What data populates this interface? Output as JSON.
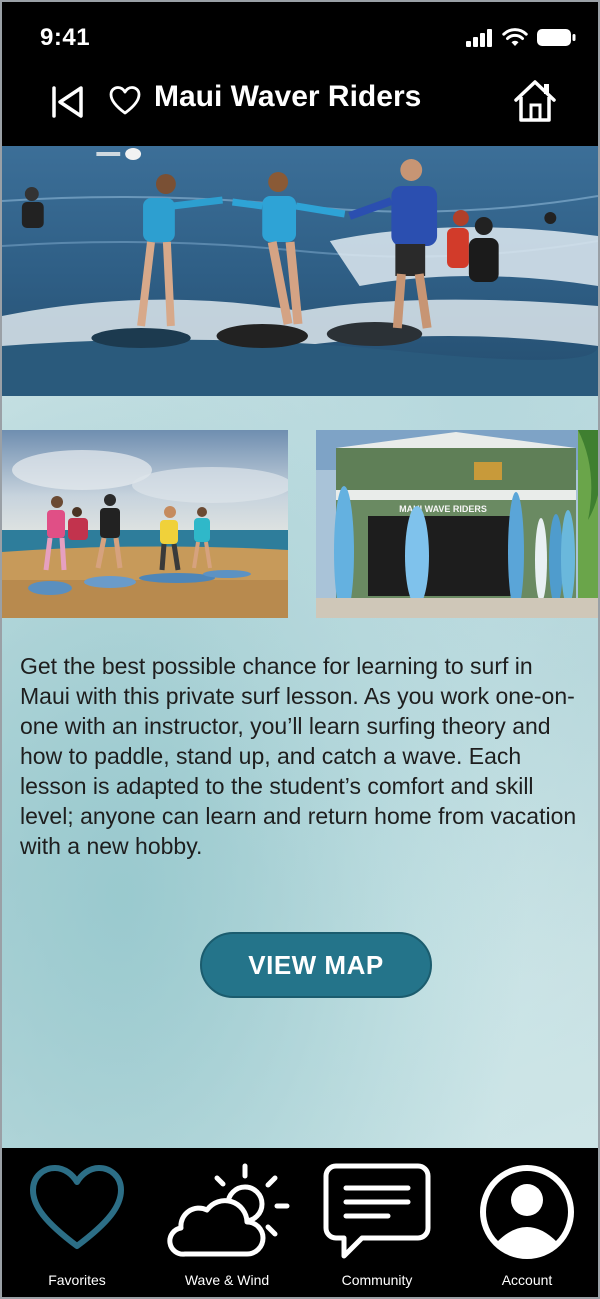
{
  "status_bar": {
    "time": "9:41"
  },
  "header": {
    "title": "Maui Waver Riders"
  },
  "description": "Get the best possible chance for learning to surf in Maui with this private surf lesson. As you work one-on-one with an instructor, you’ll learn surfing theory and how to paddle, stand up, and catch a wave. Each lesson is adapted to the student’s comfort and skill level; anyone can learn and return home from vacation with a new hobby.",
  "shop_sign": "MAUI WAVE RIDERS",
  "view_map_label": "VIEW MAP",
  "tabs": [
    {
      "label": "Favorites",
      "icon": "heart-icon",
      "active": true
    },
    {
      "label": "Wave & Wind",
      "icon": "weather-icon",
      "active": false
    },
    {
      "label": "Community",
      "icon": "chat-icon",
      "active": false
    },
    {
      "label": "Account",
      "icon": "account-icon",
      "active": false
    }
  ],
  "colors": {
    "accent": "#24748a",
    "active_tab": "#2c6e86",
    "bar_bg": "#000000"
  }
}
